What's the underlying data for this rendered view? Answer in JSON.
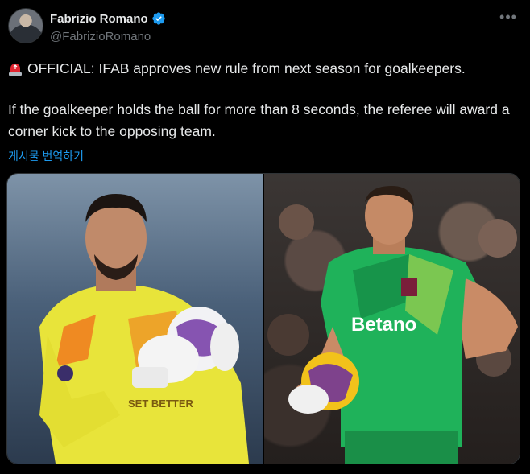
{
  "author": {
    "name": "Fabrizio Romano",
    "handle": "@FabrizioRomano"
  },
  "icons": {
    "verified": "verified-badge-icon",
    "more": "more-options-icon",
    "siren": "rotating-light-emoji-icon"
  },
  "post": {
    "line1": "OFFICIAL: IFAB approves new rule from next season for goalkeepers.",
    "line2": "If the goalkeeper holds the ball for more than 8 seconds, the referee will award a corner kick to the opposing team.",
    "translate_label": "게시물 번역하기"
  },
  "media": {
    "left_shirt_text": "SET BETTER",
    "right_sponsor_text": "Betano"
  },
  "colors": {
    "accent": "#1d9bf0",
    "text": "#e7e9ea",
    "muted": "#71767b",
    "background": "#000000"
  }
}
